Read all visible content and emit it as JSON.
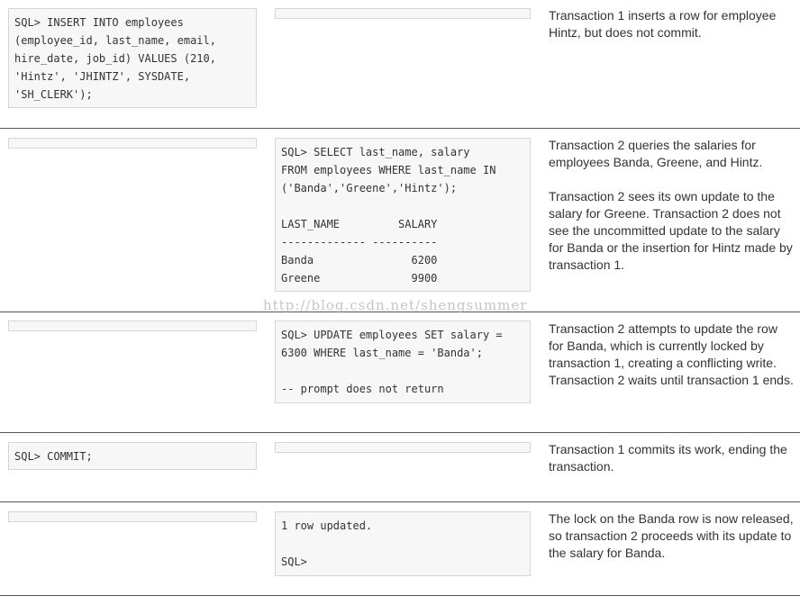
{
  "rows": [
    {
      "session1_code": "SQL> INSERT INTO employees\n(employee_id, last_name, email,\nhire_date, job_id) VALUES (210,\n'Hintz', 'JHINTZ', SYSDATE,\n'SH_CLERK');",
      "session2_code": "",
      "description": [
        "Transaction 1 inserts a row for employee Hintz, but does not commit."
      ]
    },
    {
      "session1_code": "",
      "session2_code": "SQL> SELECT last_name, salary\nFROM employees WHERE last_name IN\n('Banda','Greene','Hintz');\n\nLAST_NAME         SALARY\n------------- ----------\nBanda               6200\nGreene              9900",
      "description": [
        "Transaction 2 queries the salaries for employees Banda, Greene, and Hintz.",
        "Transaction 2 sees its own update to the salary for Greene. Transaction 2 does not see the uncommitted update to the salary for Banda or the insertion for Hintz made by transaction 1."
      ]
    },
    {
      "session1_code": "",
      "session2_code": "SQL> UPDATE employees SET salary =\n6300 WHERE last_name = 'Banda';\n\n-- prompt does not return",
      "description": [
        "Transaction 2 attempts to update the row for Banda, which is currently locked by transaction 1, creating a conflicting write. Transaction 2 waits until transaction 1 ends."
      ]
    },
    {
      "session1_code": "SQL> COMMIT;",
      "session2_code": "",
      "description": [
        "Transaction 1 commits its work, ending the transaction."
      ]
    },
    {
      "session1_code": "",
      "session2_code": "1 row updated.\n\nSQL>",
      "description": [
        "The lock on the Banda row is now released, so transaction 2 proceeds with its update to the salary for Banda."
      ]
    }
  ],
  "watermark": "http://blog.csdn.net/shengsummer"
}
